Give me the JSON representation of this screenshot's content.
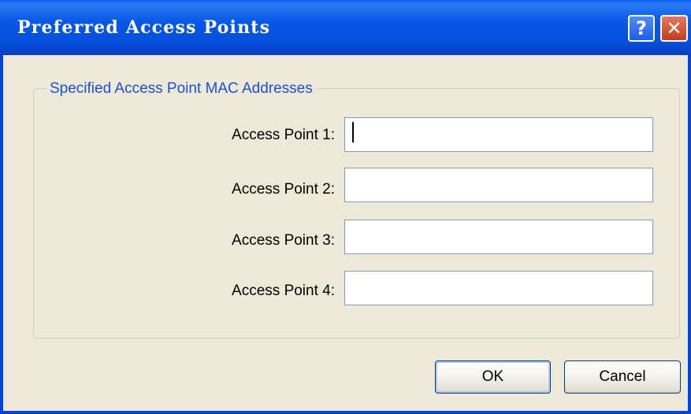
{
  "window": {
    "title": "Preferred Access Points",
    "help_glyph": "?",
    "close_glyph": "✕"
  },
  "group": {
    "legend": "Specified Access Point MAC Addresses"
  },
  "fields": [
    {
      "label": "Access Point 1:",
      "value": "",
      "focused": true
    },
    {
      "label": "Access Point 2:",
      "value": "",
      "focused": false
    },
    {
      "label": "Access Point 3:",
      "value": "",
      "focused": false
    },
    {
      "label": "Access Point 4:",
      "value": "",
      "focused": false
    }
  ],
  "buttons": {
    "ok": "OK",
    "cancel": "Cancel"
  },
  "colors": {
    "titlebar": "#0857e6",
    "dialog_bg": "#ece9d8",
    "legend_text": "#1f4fd0",
    "close_button": "#c33d1b"
  },
  "icons": {
    "help": "help-icon",
    "close": "close-icon"
  }
}
